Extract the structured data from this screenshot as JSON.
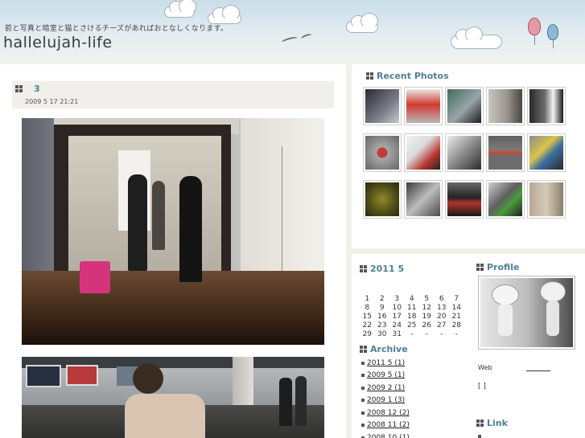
{
  "header": {
    "tagline": "箭と写真と暗室と猫とさけるチーズがあればおとなしくなります。",
    "title": "hallelujah-life"
  },
  "post": {
    "title": "3",
    "date": "2009 5 17  21:21"
  },
  "sidebar": {
    "recent_photos": {
      "title": "Recent Photos",
      "count": 15
    },
    "calendar": {
      "title": "2011  5",
      "weeks": [
        [
          "",
          "",
          "",
          "",
          "",
          "",
          ""
        ],
        [
          "1",
          "2",
          "3",
          "4",
          "5",
          "6",
          "7"
        ],
        [
          "8",
          "9",
          "10",
          "11",
          "12",
          "13",
          "14"
        ],
        [
          "15",
          "16",
          "17",
          "18",
          "19",
          "20",
          "21"
        ],
        [
          "22",
          "23",
          "24",
          "25",
          "26",
          "27",
          "28"
        ],
        [
          "29",
          "30",
          "31",
          "-",
          "-",
          "-",
          "-"
        ]
      ]
    },
    "archive": {
      "title": "Archive",
      "items": [
        "2011 5  (1)",
        "2009 5  (1)",
        "2009 2  (1)",
        "2009 1  (3)",
        "2008 12  (2)",
        "2008 11  (2)",
        "2008 10  (1)"
      ]
    },
    "profile": {
      "title": "Profile",
      "web_label": "Web",
      "bracket": "[        ]"
    },
    "link": {
      "title": "Link"
    }
  },
  "colors": {
    "accent": "#4d7f96",
    "page_bg": "#f1f1ec",
    "header_sky": "#c9dde8"
  }
}
